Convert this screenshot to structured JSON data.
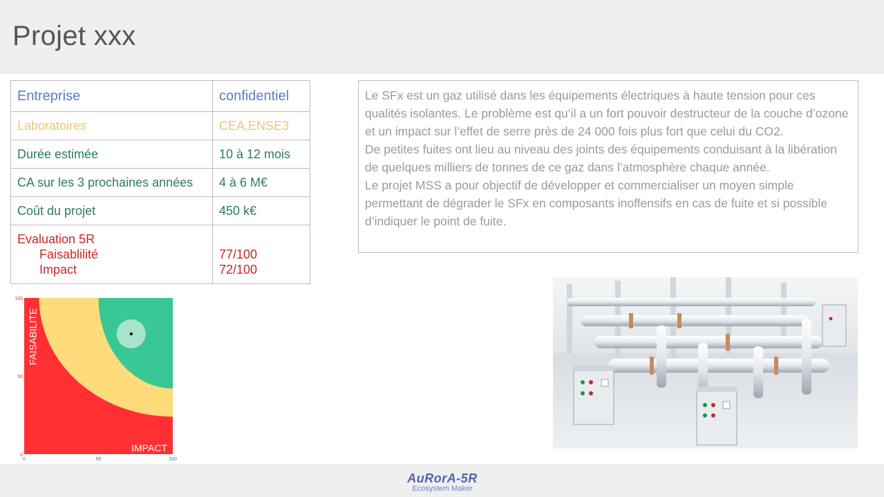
{
  "title": "Projet xxx",
  "table": {
    "entreprise": {
      "label": "Entreprise",
      "value": "confidentiel"
    },
    "laboratoires": {
      "label": "Laboratoires",
      "value": "CEA,ENSE3"
    },
    "duree": {
      "label": "Durée estimée",
      "value": "10 à 12 mois"
    },
    "ca": {
      "label": "CA sur les 3 prochaines années",
      "value": "4 à 6 M€"
    },
    "cout": {
      "label": "Coût du projet",
      "value": "450 k€"
    },
    "evaluation": {
      "label": "Evaluation 5R",
      "faisabilite_label": "Faisablilité",
      "faisabilite_value": "77/100",
      "impact_label": "Impact",
      "impact_value": "72/100"
    }
  },
  "description": {
    "p1": "Le SFx est un gaz utilisé dans les équipements électriques à haute tension pour ces qualités isolantes. Le problème est qu’il a un fort pouvoir destructeur de la couche d’ozone et un impact sur l’effet de serre près de 24 000 fois plus fort que celui du CO2.",
    "p2": "De petites fuites ont lieu au niveau des joints des équipements conduisant à la libération de quelques milliers de tonnes de ce gaz dans l’atmosphère chaque année.",
    "p3": "Le projet MSS a pour objectif de développer et commercialiser un moyen simple permettant de dégrader le SFx en composants inoffensifs en cas de fuite et si possible d’indiquer le point de fuite."
  },
  "chart_data": {
    "type": "scatter",
    "xlabel": "IMPACT",
    "ylabel": "FAISABILITE",
    "xlim": [
      0,
      100
    ],
    "ylim": [
      0,
      100
    ],
    "x_ticks": [
      "0",
      "50",
      "100"
    ],
    "y_ticks": [
      "0",
      "50",
      "100"
    ],
    "zones": [
      {
        "name": "red",
        "color": "#fe3033"
      },
      {
        "name": "yellow",
        "color": "#ffdb7c"
      },
      {
        "name": "green",
        "color": "#38c795"
      }
    ],
    "points": [
      {
        "x": 72,
        "y": 77
      }
    ]
  },
  "footer": {
    "logo_main": "AuRorA-5R",
    "logo_sub": "Ecosystem Maker"
  },
  "colors": {
    "entreprise": "#5a7dc0",
    "laboratoires": "#e8c774",
    "green_rows": "#2e7d5a",
    "evaluation": "#c62828",
    "description": "#9a9a9a"
  }
}
